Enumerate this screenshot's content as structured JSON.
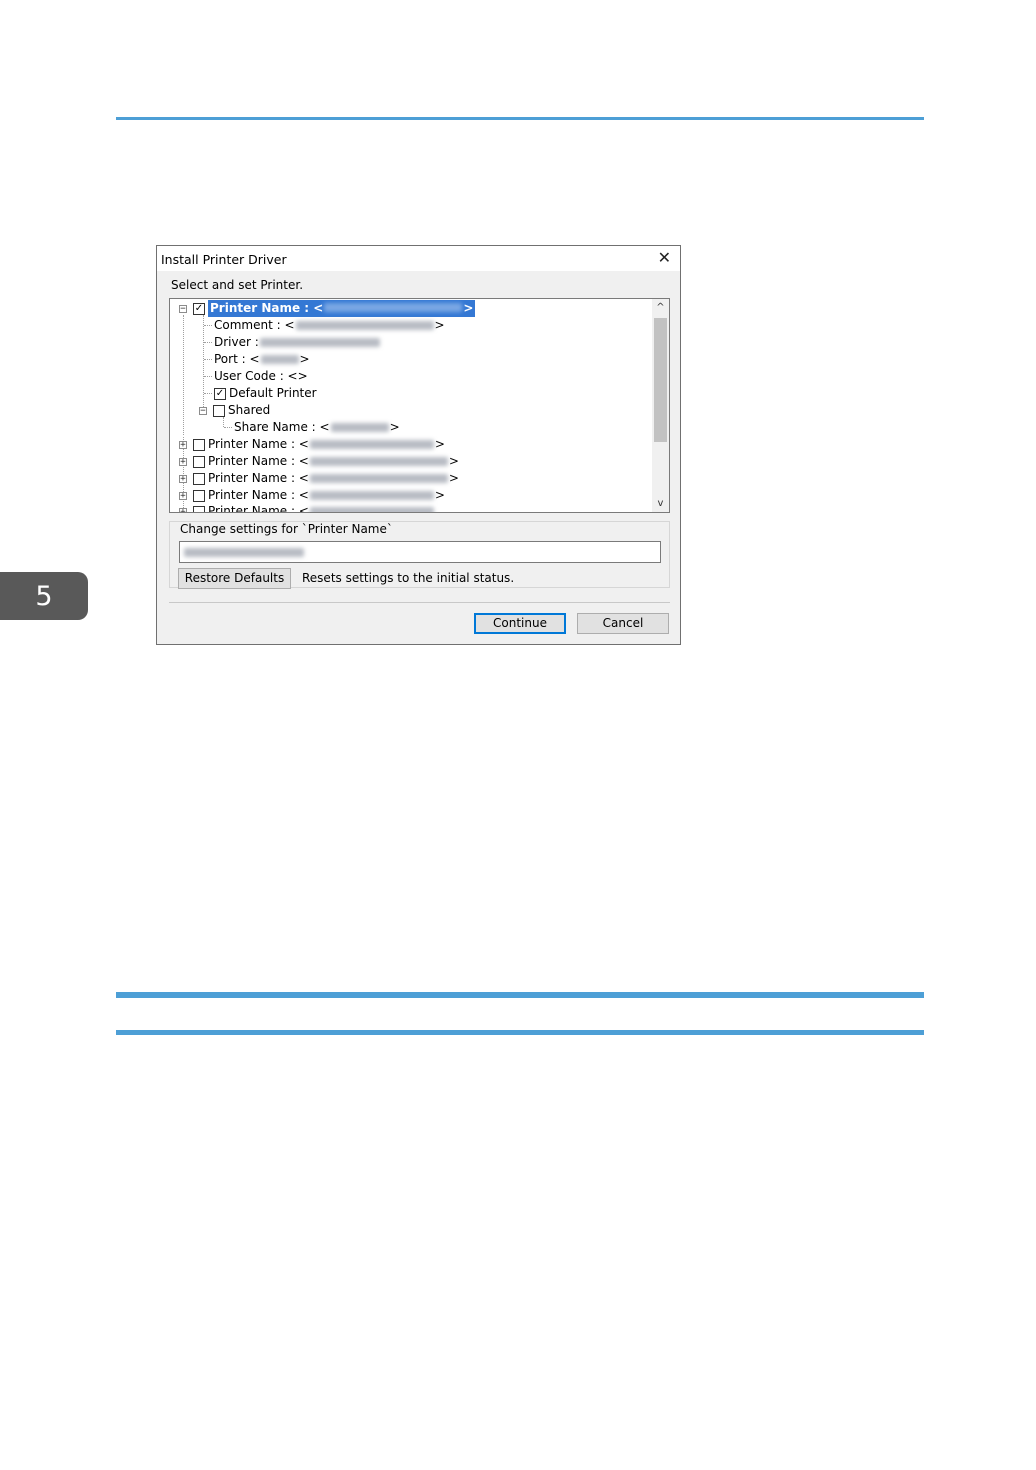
{
  "page": {
    "chapter_number": "5"
  },
  "dialog": {
    "title": "Install Printer Driver",
    "instruction": "Select and set Printer.",
    "tree": {
      "selected_printer_label": "Printer Name : <",
      "selected_printer_close": ">",
      "comment_label": "Comment : <",
      "comment_close": ">",
      "driver_label": "Driver : ",
      "port_label": "Port : <",
      "port_close": ">",
      "user_code_label": "User Code : <>",
      "default_printer_label": "Default Printer",
      "shared_label": "Shared",
      "share_name_label": "Share Name : <",
      "share_name_close": ">",
      "printer_name_label": "Printer Name : <",
      "printer_name_close": ">",
      "last_partial_label": "Printer Name : <",
      "checkmark": "✓",
      "expand_symbol": "+",
      "collapse_symbol": "−"
    },
    "scroll_up_icon": "^",
    "scroll_down_icon": "v",
    "group_label": "Change settings for `Printer Name`",
    "restore_label": "Restore Defaults",
    "restore_description": "Resets settings to the initial status.",
    "continue_label": "Continue",
    "cancel_label": "Cancel",
    "close_icon": "✕"
  },
  "colors": {
    "accent_rule": "#4d9fd6",
    "selection": "#3478d4",
    "chapter_tab": "#595959"
  }
}
